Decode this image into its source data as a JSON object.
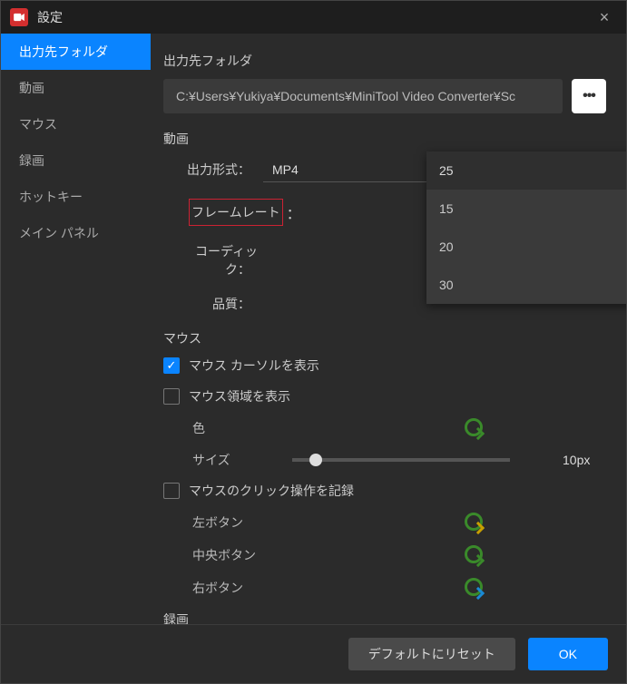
{
  "title": "設定",
  "sidebar": {
    "items": [
      {
        "label": "出力先フォルダ"
      },
      {
        "label": "動画"
      },
      {
        "label": "マウス"
      },
      {
        "label": "録画"
      },
      {
        "label": "ホットキー"
      },
      {
        "label": "メイン パネル"
      }
    ]
  },
  "output": {
    "section": "出力先フォルダ",
    "path": "C:¥Users¥Yukiya¥Documents¥MiniTool Video Converter¥Sc"
  },
  "video": {
    "section": "動画",
    "format_label": "出力形式",
    "format_value": "MP4",
    "framerate_label": "フレームレート",
    "framerate_value": "25",
    "framerate_options": [
      "15",
      "20",
      "30"
    ],
    "codec_label": "コーディック",
    "quality_label": "品質"
  },
  "mouse": {
    "section": "マウス",
    "show_cursor": "マウス カーソルを表示",
    "show_area": "マウス領域を表示",
    "color_label": "色",
    "size_label": "サイズ",
    "size_value": "10px",
    "record_clicks": "マウスのクリック操作を記録",
    "left": "左ボタン",
    "middle": "中央ボタン",
    "right": "右ボタン"
  },
  "rec": {
    "section": "録画"
  },
  "buttons": {
    "reset": "デフォルトにリセット",
    "ok": "OK"
  }
}
